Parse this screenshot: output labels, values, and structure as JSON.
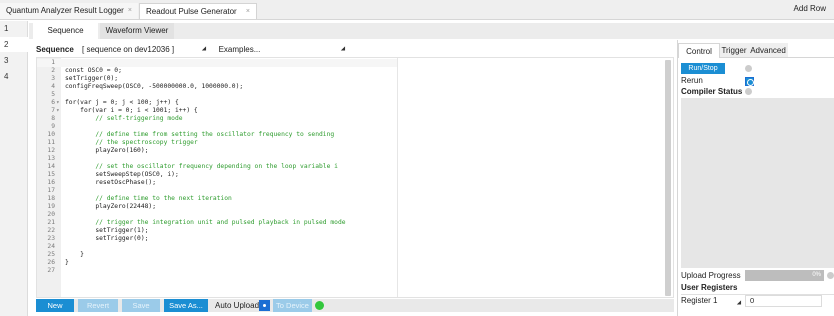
{
  "top_tabs": [
    {
      "label": "Quantum Analyzer Result Logger",
      "close": "×"
    },
    {
      "label": "Readout Pulse Generator",
      "close": "×"
    }
  ],
  "add_row_label": "Add Row",
  "gutter_rows": [
    "1",
    "2",
    "3",
    "4"
  ],
  "sub_tabs": [
    "Sequence",
    "Waveform Viewer"
  ],
  "sequence_header": {
    "label": "Sequence",
    "selector": "[ sequence on dev12036 ]",
    "examples": "Examples..."
  },
  "code_lines": [
    {
      "n": "1",
      "t": ""
    },
    {
      "n": "2",
      "t": "const OSC0 = 0;"
    },
    {
      "n": "3",
      "t": "setTrigger(0);"
    },
    {
      "n": "4",
      "t": "configFreqSweep(OSC0, -500000000.0, 1000000.0);"
    },
    {
      "n": "5",
      "t": ""
    },
    {
      "n": "6",
      "t": "for(var j = 0; j < 100; j++) {",
      "fold": "▾"
    },
    {
      "n": "7",
      "t": "    for(var i = 0; i < 1001; i++) {",
      "fold": "▾"
    },
    {
      "n": "8",
      "t": "        // self-triggering mode",
      "comment": true
    },
    {
      "n": "9",
      "t": ""
    },
    {
      "n": "10",
      "t": "        // define time from setting the oscillator frequency to sending",
      "comment": true
    },
    {
      "n": "11",
      "t": "        // the spectroscopy trigger",
      "comment": true
    },
    {
      "n": "12",
      "t": "        playZero(160);"
    },
    {
      "n": "13",
      "t": ""
    },
    {
      "n": "14",
      "t": "        // set the oscillator frequency depending on the loop variable i",
      "comment": true
    },
    {
      "n": "15",
      "t": "        setSweepStep(OSC0, i);"
    },
    {
      "n": "16",
      "t": "        resetOscPhase();"
    },
    {
      "n": "17",
      "t": ""
    },
    {
      "n": "18",
      "t": "        // define time to the next iteration",
      "comment": true
    },
    {
      "n": "19",
      "t": "        playZero(22448);"
    },
    {
      "n": "20",
      "t": ""
    },
    {
      "n": "21",
      "t": "        // trigger the integration unit and pulsed playback in pulsed mode",
      "comment": true
    },
    {
      "n": "22",
      "t": "        setTrigger(1);"
    },
    {
      "n": "23",
      "t": "        setTrigger(0);"
    },
    {
      "n": "24",
      "t": ""
    },
    {
      "n": "25",
      "t": "    }"
    },
    {
      "n": "26",
      "t": "}"
    },
    {
      "n": "27",
      "t": ""
    }
  ],
  "bottom_buttons": {
    "new": "New",
    "revert": "Revert",
    "save": "Save",
    "save_as": "Save As...",
    "auto_upload": "Auto Upload",
    "to_device": "To Device"
  },
  "right_panel": {
    "tabs": [
      "Control",
      "Trigger",
      "Advanced"
    ],
    "run_stop": "Run/Stop",
    "rerun": "Rerun",
    "compiler_status": "Compiler Status",
    "upload_progress": "Upload Progress",
    "upload_progress_value": 0,
    "upload_progress_text": "0%",
    "user_registers": "User Registers",
    "register_1_label": "Register 1",
    "register_1_value": "0"
  },
  "colors": {
    "accent": "#1b8ed3",
    "comment": "#2e9c2e",
    "status_ok": "#33c73d"
  }
}
